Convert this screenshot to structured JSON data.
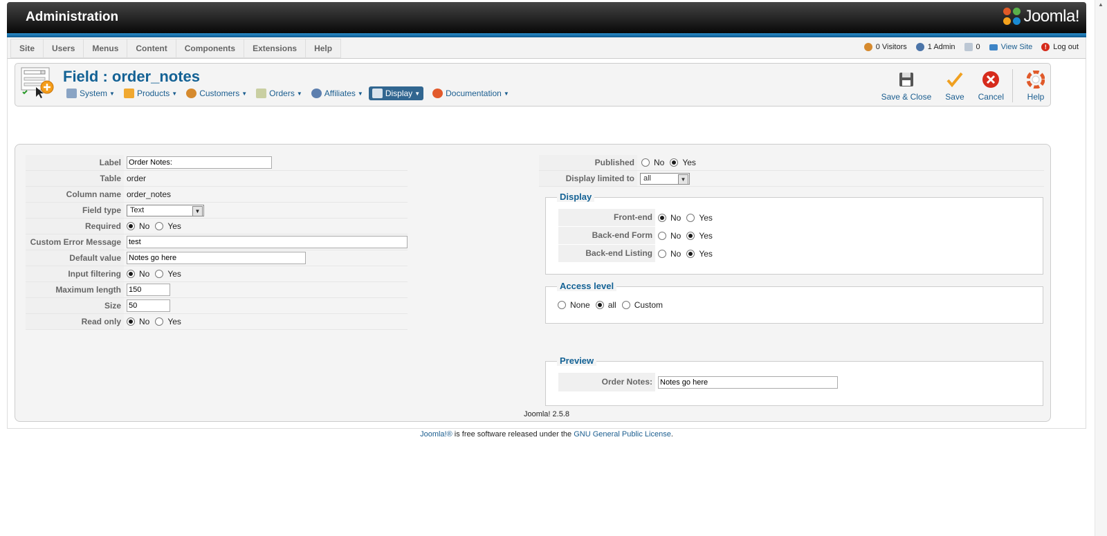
{
  "header": {
    "title": "Administration",
    "logo_text": "Joomla!"
  },
  "menu": {
    "items": [
      "Site",
      "Users",
      "Menus",
      "Content",
      "Components",
      "Extensions",
      "Help"
    ]
  },
  "status": {
    "visitors": "0 Visitors",
    "admins": "1 Admin",
    "messages": "0",
    "view_site": "View Site",
    "logout": "Log out"
  },
  "toolbar": {
    "title": "Field : order_notes",
    "vm_menu": [
      {
        "label": "System",
        "icon": "wrench-icon"
      },
      {
        "label": "Products",
        "icon": "box-icon"
      },
      {
        "label": "Customers",
        "icon": "users-icon"
      },
      {
        "label": "Orders",
        "icon": "orders-icon"
      },
      {
        "label": "Affiliates",
        "icon": "affiliates-icon"
      },
      {
        "label": "Display",
        "icon": "display-icon"
      },
      {
        "label": "Documentation",
        "icon": "lifebuoy-icon"
      }
    ],
    "save_close": "Save & Close",
    "save": "Save",
    "cancel": "Cancel",
    "help": "Help"
  },
  "form": {
    "label": {
      "label": "Label",
      "value": "Order Notes:"
    },
    "table": {
      "label": "Table",
      "value": "order"
    },
    "column": {
      "label": "Column name",
      "value": "order_notes"
    },
    "field_type": {
      "label": "Field type",
      "value": "Text"
    },
    "required": {
      "label": "Required",
      "no": "No",
      "yes": "Yes",
      "selected": "No"
    },
    "custom_error": {
      "label": "Custom Error Message",
      "value": "test"
    },
    "default_value": {
      "label": "Default value",
      "value": "Notes go here"
    },
    "input_filtering": {
      "label": "Input filtering",
      "no": "No",
      "yes": "Yes",
      "selected": "No"
    },
    "max_length": {
      "label": "Maximum length",
      "value": "150"
    },
    "size": {
      "label": "Size",
      "value": "50"
    },
    "read_only": {
      "label": "Read only",
      "no": "No",
      "yes": "Yes",
      "selected": "No"
    }
  },
  "right": {
    "published": {
      "label": "Published",
      "no": "No",
      "yes": "Yes",
      "selected": "Yes"
    },
    "display_limited": {
      "label": "Display limited to",
      "value": "all"
    },
    "display": {
      "legend": "Display",
      "front_end": {
        "label": "Front-end",
        "no": "No",
        "yes": "Yes",
        "selected": "No"
      },
      "backend_form": {
        "label": "Back-end Form",
        "no": "No",
        "yes": "Yes",
        "selected": "Yes"
      },
      "backend_listing": {
        "label": "Back-end Listing",
        "no": "No",
        "yes": "Yes",
        "selected": "Yes"
      }
    },
    "access": {
      "legend": "Access level",
      "none": "None",
      "all": "all",
      "custom": "Custom",
      "selected": "all"
    },
    "preview": {
      "legend": "Preview",
      "label": "Order Notes:",
      "value": "Notes go here"
    }
  },
  "footer": {
    "version": "Joomla! 2.5.8",
    "joomla_link": "Joomla!®",
    "text": "is free software released under the",
    "license": "GNU General Public License",
    "period": "."
  }
}
